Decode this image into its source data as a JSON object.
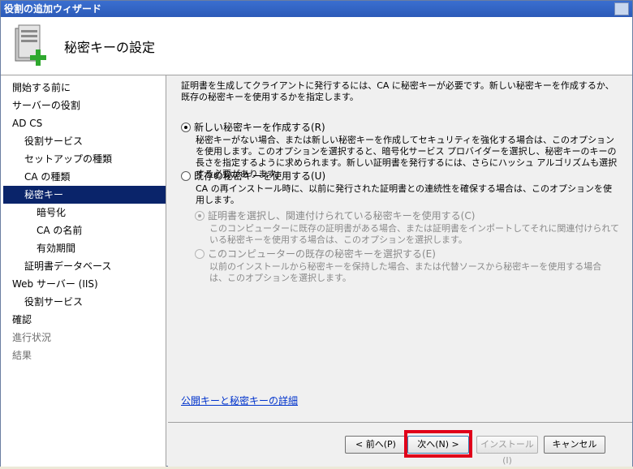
{
  "window": {
    "title": "役割の追加ウィザード"
  },
  "header": {
    "title": "秘密キーの設定",
    "icon": "server-role-add-icon"
  },
  "sidebar": {
    "items": [
      {
        "label": "開始する前に",
        "level": 0,
        "state": "normal"
      },
      {
        "label": "サーバーの役割",
        "level": 0,
        "state": "normal"
      },
      {
        "label": "AD CS",
        "level": 0,
        "state": "normal"
      },
      {
        "label": "役割サービス",
        "level": 1,
        "state": "normal"
      },
      {
        "label": "セットアップの種類",
        "level": 1,
        "state": "normal"
      },
      {
        "label": "CA の種類",
        "level": 1,
        "state": "normal"
      },
      {
        "label": "秘密キー",
        "level": 1,
        "state": "active"
      },
      {
        "label": "暗号化",
        "level": 2,
        "state": "normal"
      },
      {
        "label": "CA の名前",
        "level": 2,
        "state": "normal"
      },
      {
        "label": "有効期間",
        "level": 2,
        "state": "normal"
      },
      {
        "label": "証明書データベース",
        "level": 1,
        "state": "normal"
      },
      {
        "label": "Web サーバー (IIS)",
        "level": 0,
        "state": "normal"
      },
      {
        "label": "役割サービス",
        "level": 1,
        "state": "normal"
      },
      {
        "label": "確認",
        "level": 0,
        "state": "normal"
      },
      {
        "label": "進行状況",
        "level": 0,
        "state": "disabled"
      },
      {
        "label": "結果",
        "level": 0,
        "state": "disabled"
      }
    ]
  },
  "main": {
    "intro": "証明書を生成してクライアントに発行するには、CA に秘密キーが必要です。新しい秘密キーを作成するか、既存の秘密キーを使用するかを指定します。",
    "options": [
      {
        "label": "新しい秘密キーを作成する(R)",
        "desc": "秘密キーがない場合、または新しい秘密キーを作成してセキュリティを強化する場合は、このオプションを使用します。このオプションを選択すると、暗号化サービス プロバイダーを選択し、秘密キーのキーの長さを指定するように求められます。新しい証明書を発行するには、さらにハッシュ アルゴリズムも選択する必要があります。"
      },
      {
        "label": "既存の秘密キーを使用する(U)",
        "desc": "CA の再インストール時に、以前に発行された証明書との連続性を確保する場合は、このオプションを使用します。"
      },
      {
        "label": "証明書を選択し、関連付けられている秘密キーを使用する(C)",
        "desc": "このコンピューターに既存の証明書がある場合、または証明書をインポートしてそれに関連付けられている秘密キーを使用する場合は、このオプションを選択します。"
      },
      {
        "label": "このコンピューターの既存の秘密キーを選択する(E)",
        "desc": "以前のインストールから秘密キーを保持した場合、または代替ソースから秘密キーを使用する場合は、このオプションを選択します。"
      }
    ],
    "selected_option": "新しい秘密キーを作成する(R)",
    "link": "公開キーと秘密キーの詳細"
  },
  "footer": {
    "back": "< 前へ(P)",
    "next": "次へ(N) >",
    "install": "インストール(I)",
    "cancel": "キャンセル"
  },
  "colors": {
    "active_nav": "#0a246a",
    "highlight": "#e0001a",
    "link": "#0033cc"
  }
}
